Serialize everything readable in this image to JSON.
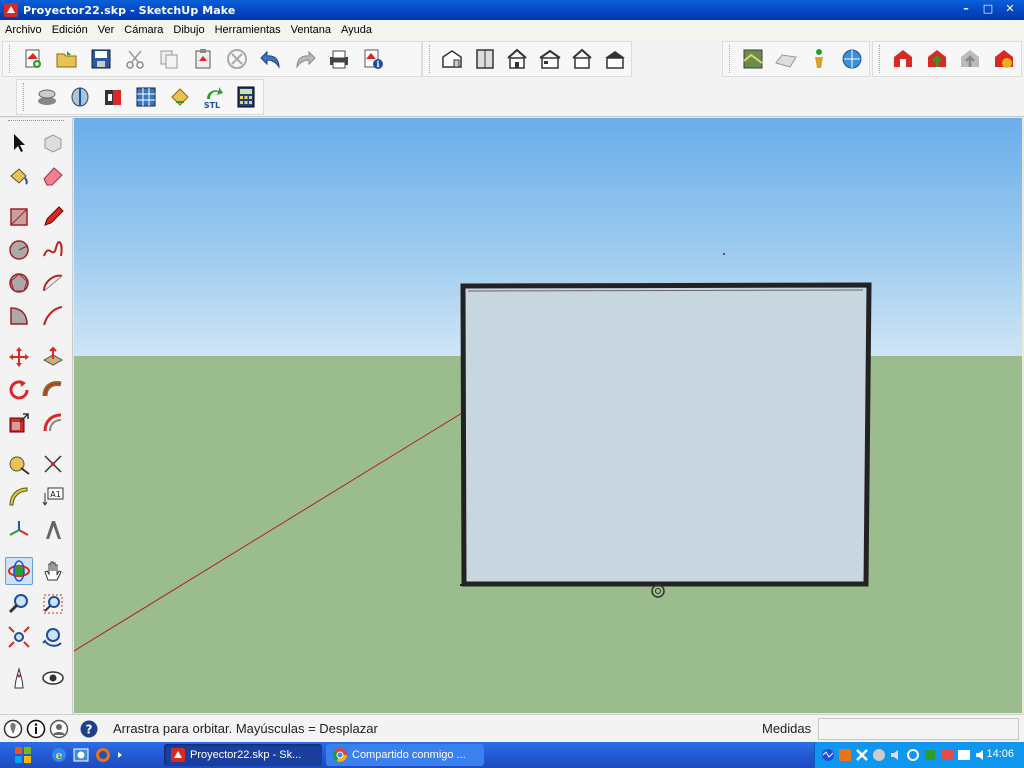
{
  "window": {
    "title": "Proyector22.skp - SketchUp Make",
    "minimize": "–",
    "maximize": "□",
    "close": "✕"
  },
  "menu": [
    "Archivo",
    "Edición",
    "Ver",
    "Cámara",
    "Dibujo",
    "Herramientas",
    "Ventana",
    "Ayuda"
  ],
  "toolbar": {
    "row1_main": [
      "new-icon",
      "open-icon",
      "save-icon",
      "cut-icon",
      "copy-icon",
      "paste-icon",
      "erase-icon",
      "undo-icon",
      "redo-icon",
      "print-icon",
      "model-info-icon"
    ],
    "row1_views": [
      "iso-view-icon",
      "top-view-icon",
      "front-view-icon",
      "right-view-icon",
      "back-view-icon",
      "left-view-icon"
    ],
    "row1_right_a": [
      "add-location-icon",
      "toggle-terrain-icon",
      "get-models-icon",
      "photo-texture-icon"
    ],
    "row1_right_b": [
      "get-models-icon",
      "share-model-icon",
      "share-component-icon",
      "extension-warehouse-icon"
    ],
    "row2": [
      "sandbox-icon",
      "section-icon",
      "solid-icon",
      "grid-icon",
      "shadow-icon",
      "stl-icon",
      "calculator-icon"
    ],
    "stl_label": "STL"
  },
  "palette": [
    [
      "select-icon",
      "component-icon"
    ],
    [
      "paint-bucket-icon",
      "eraser-icon"
    ],
    [
      "rectangle-icon",
      "pencil-icon"
    ],
    [
      "circle-icon",
      "freehand-icon"
    ],
    [
      "polygon-icon",
      "arc-icon"
    ],
    [
      "pie-icon",
      "arc3-icon"
    ],
    [
      "move-icon",
      "push-pull-icon"
    ],
    [
      "rotate-icon",
      "follow-me-icon"
    ],
    [
      "scale-icon",
      "offset-icon"
    ],
    [
      "tape-measure-icon",
      "dimension-icon"
    ],
    [
      "protractor-icon",
      "text-icon"
    ],
    [
      "axes-icon",
      "3d-text-icon"
    ],
    [
      "orbit-icon",
      "pan-icon"
    ],
    [
      "zoom-icon",
      "zoom-window-icon"
    ],
    [
      "zoom-extents-icon",
      "previous-view-icon"
    ],
    [
      "walk-icon",
      "look-around-icon"
    ]
  ],
  "text_tool_label": "A1",
  "status": {
    "hint": "Arrastra para orbitar. Mayúsculas = Desplazar",
    "measure_label": "Medidas",
    "measure_value": ""
  },
  "taskbar": {
    "tasks": [
      {
        "label": "Proyector22.skp - Sk...",
        "active": true
      },
      {
        "label": "Compartido conmigo ...",
        "active": false
      }
    ],
    "clock": "14:06"
  },
  "colors": {
    "sky_top": "#6aaeea",
    "ground": "#9bbd8d",
    "model_face": "#c8d6e0",
    "red_axis": "#b02020"
  }
}
